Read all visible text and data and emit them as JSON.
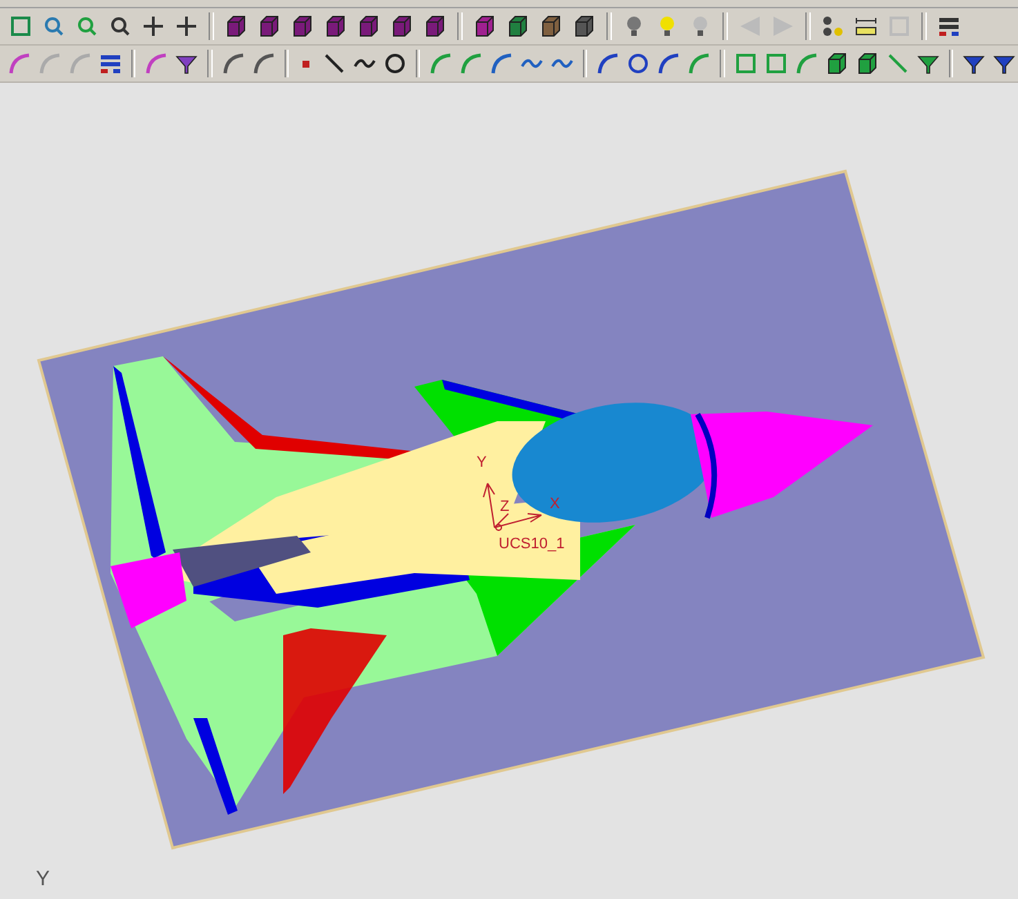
{
  "viewport": {
    "axis_labels": [
      {
        "kind": "y",
        "text": "Y"
      },
      {
        "kind": "z",
        "text": "Z"
      },
      {
        "kind": "x",
        "text": "X"
      }
    ],
    "csys_name": "UCS10_1",
    "corner_axis": "Y"
  }
}
